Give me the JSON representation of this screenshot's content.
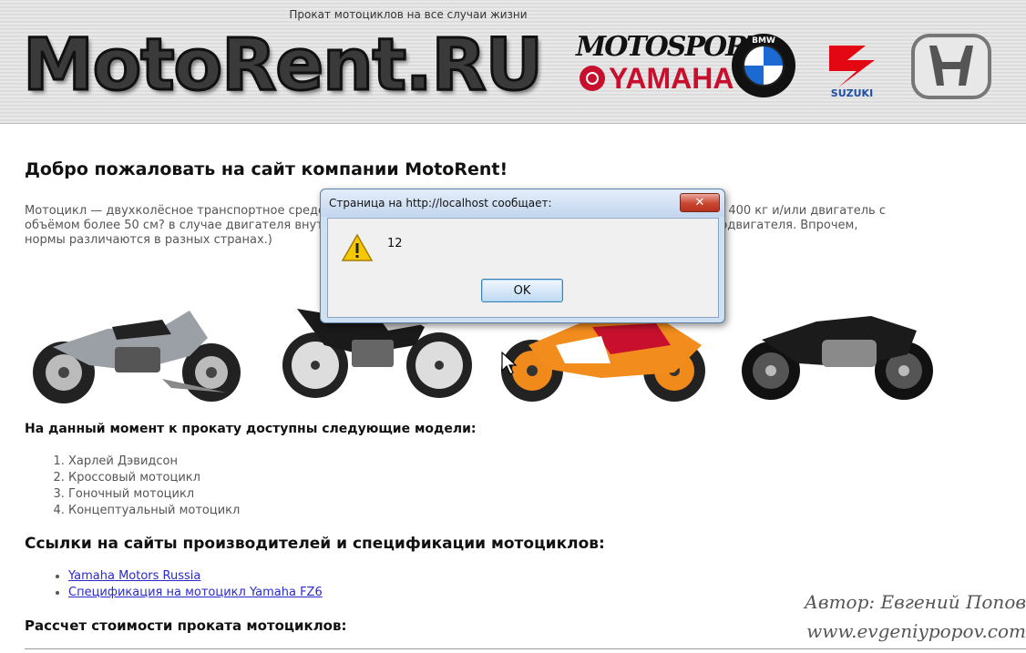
{
  "header": {
    "tagline": "Прокат мотоциклов на все случаи жизни",
    "logo_text": "MotoRent.RU",
    "brands": {
      "motosport": "MOTOSPORT",
      "yamaha": "YAMAHA",
      "bmw": "BMW",
      "suzuki": "SUZUKI",
      "honda": "HONDA"
    },
    "colors": {
      "yamaha_red": "#c8102e",
      "suzuki_red": "#e30613",
      "bmw_blue": "#1c69d4"
    }
  },
  "main": {
    "welcome_title": "Добро пожаловать на сайт компании MotoRent!",
    "intro_line1": "Мотоцикл — двухколёсное транспортное средство с механическим двигателем, массой без нагрузки не более 400 кг и/или двигатель с",
    "intro_line2": "объёмом более 50 см? в случае двигателя внутреннего сгорания или мощностью более 4 кВт в случае электродвигателя. Впрочем,",
    "intro_line3": "нормы различаются в разных странах.)",
    "bikes": [
      "harley-davidson",
      "cross",
      "racing",
      "concept"
    ],
    "available_title": "На данный момент к прокату доступны следующие модели:",
    "models": [
      "Харлей Дэвидсон",
      "Кроссовый мотоцикл",
      "Гоночный мотоцикл",
      "Концептуальный мотоцикл"
    ],
    "links_title": "Ссылки на сайты производителей и спецификации мотоциклов:",
    "links": [
      "Yamaha Motors Russia",
      "Спецификация на мотоцикл Yamaha FZ6"
    ],
    "cost_title": "Рассчет стоимости проката мотоциклов:"
  },
  "author": {
    "name": "Автор: Евгений Попов",
    "site": "www.evgeniypopov.com"
  },
  "dialog": {
    "title": "Страница на http://localhost сообщает:",
    "message": "12",
    "ok_label": "OK",
    "close_glyph": "✕",
    "icon": "warning-icon"
  }
}
